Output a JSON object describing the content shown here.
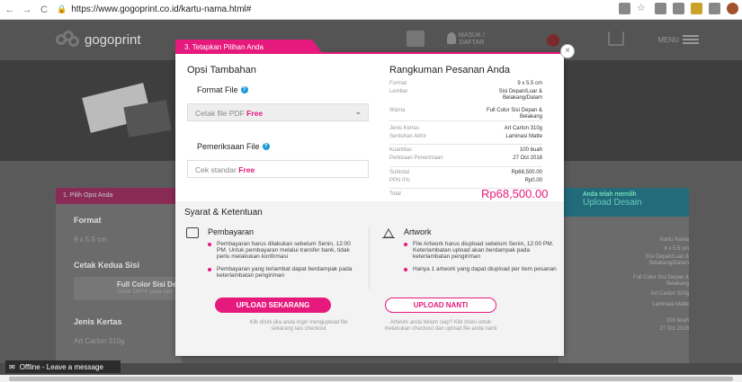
{
  "browser": {
    "url": "https://www.gogoprint.co.id/kartu-nama.html#"
  },
  "site": {
    "logo": "gogoprint",
    "login": "MASUK /\nDAFTAR",
    "menu": "MENU"
  },
  "background": {
    "left_tab": "1. Pilih Opsi Anda",
    "format_label": "Format",
    "format_value": "9 x 5.5 cm",
    "cetak_label": "Cetak Kedua Sisi",
    "cetak_opt": "Full Color Sisi De",
    "cetak_sub": "Cetak CMYK pada ked",
    "jenis_label": "Jenis Kertas",
    "jenis_value": "Art Carton 310g",
    "right_head1": "Anda telah memilih",
    "right_head2": "Upload Desain",
    "right_rows": [
      "Kartu Nama",
      "9 x 5.5 cm",
      "Sisi Depan/Luar &\nBelakang/Dalam",
      "Full Color Sisi Depan &\nBelakang",
      "Art Carton 310g",
      "Laminasi Matte",
      "100 buah",
      "27 Oct 2018"
    ]
  },
  "modal": {
    "tab": "3. Tetapkan Pilihan Anda",
    "opsi_title": "Opsi Tambahan",
    "format_file_label": "Format File",
    "format_file_value": "Cetak file PDF",
    "format_file_free": "Free",
    "pemeriksaan_label": "Pemeriksaan File",
    "pemeriksaan_value": "Cek standar",
    "pemeriksaan_free": "Free",
    "rangkuman_title": "Rangkuman Pesanan Anda",
    "summary": [
      {
        "k": "Format",
        "v": "9 x 5.5 cm"
      },
      {
        "k": "Lembar",
        "v": "Sisi Depan/Luar &\nBelakang/Dalam"
      },
      {
        "k": "Warna",
        "v": "Full Color Sisi Depan &\nBelakang"
      },
      {
        "k": "Jenis Kertas",
        "v": "Art Carton 310g"
      },
      {
        "k": "Sentuhan Akhir",
        "v": "Laminasi Matte"
      },
      {
        "k": "Kuantitas",
        "v": "100  buah"
      },
      {
        "k": "Perkiraan Penerimaan",
        "v": "27 Oct 2018"
      },
      {
        "k": "Subtotal",
        "v": "Rp68,500.00"
      },
      {
        "k": "PPN 0%",
        "v": "Rp0.00"
      },
      {
        "k": "Total",
        "v": ""
      }
    ],
    "total": "Rp68,500.00",
    "syarat_title": "Syarat & Ketentuan",
    "pembayaran_title": "Pembayaran",
    "pembayaran_bullets": [
      "Pembayaran harus dilakukan sebelum Senin, 12:00 PM. Untuk pembayaran melalui transfer bank, tidak perlu melakukan konfirmasi",
      "Pembayaran yang terlambat dapat berdampak pada keterlambatan pengiriman"
    ],
    "artwork_title": "Artwork",
    "artwork_bullets": [
      "File Artwork harus diupload sebelum Senin, 12:00 PM. Keterlambatan upload akan berdampak pada keterlambatan pengiriman",
      "Hanya 1 artwork yang dapat diupload per item pesanan"
    ],
    "btn_now": "UPLOAD SEKARANG",
    "btn_later": "UPLOAD NANTI",
    "note_now": "Klik disini jika anda ingin mengupload file sekarang lalu checkout",
    "note_later": "Artwork anda belum siap? Klik disini untuk melakukan checkout dan upload file anda nanti"
  },
  "chat": {
    "label": "Offline - Leave a message"
  },
  "colors": {
    "accent": "#e6197d",
    "help": "#1a9ad6"
  }
}
